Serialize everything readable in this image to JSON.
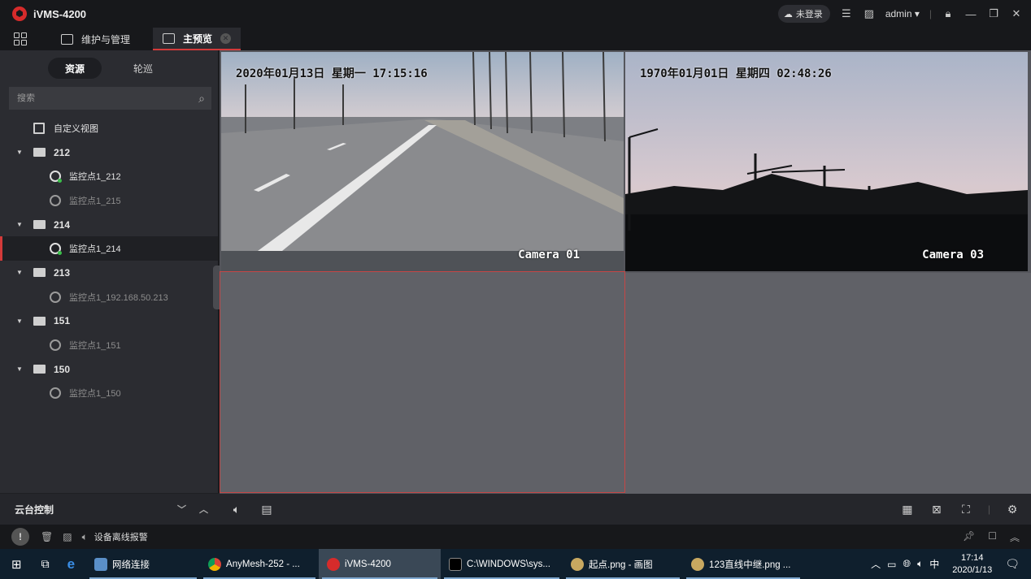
{
  "app": {
    "title": "iVMS-4200"
  },
  "titlebar": {
    "login_status": "未登录",
    "user": "admin"
  },
  "tabs": [
    {
      "label": "维护与管理"
    },
    {
      "label": "主预览"
    }
  ],
  "sidebar": {
    "segments": [
      "资源",
      "轮巡"
    ],
    "search_placeholder": "搜索",
    "custom_view": "自定义视图",
    "groups": [
      {
        "name": "212",
        "cameras": [
          {
            "label": "监控点1_212",
            "online": true
          },
          {
            "label": "监控点1_215",
            "online": false
          }
        ]
      },
      {
        "name": "214",
        "cameras": [
          {
            "label": "监控点1_214",
            "online": true,
            "selected": true
          }
        ]
      },
      {
        "name": "213",
        "cameras": [
          {
            "label": "监控点1_192.168.50.213",
            "online": false
          }
        ]
      },
      {
        "name": "151",
        "cameras": [
          {
            "label": "监控点1_151",
            "online": false
          }
        ]
      },
      {
        "name": "150",
        "cameras": [
          {
            "label": "监控点1_150",
            "online": false
          }
        ]
      }
    ],
    "ptz_label": "云台控制"
  },
  "video": {
    "pane1": {
      "timestamp": "2020年01月13日 星期一 17:15:16",
      "camera": "Camera 01"
    },
    "pane2": {
      "timestamp": "1970年01月01日 星期四 02:48:26",
      "camera": "Camera 03"
    }
  },
  "statusbar": {
    "alarm_text": "设备离线报警"
  },
  "taskbar": {
    "items": [
      {
        "label": "网络连接"
      },
      {
        "label": "AnyMesh-252 - ..."
      },
      {
        "label": "iVMS-4200"
      },
      {
        "label": "C:\\WINDOWS\\sys..."
      },
      {
        "label": "起点.png - 画图"
      },
      {
        "label": "123直线中继.png ..."
      }
    ],
    "ime": "中",
    "time": "17:14",
    "date": "2020/1/13"
  },
  "colors": {
    "accent": "#d33a3a",
    "online": "#3bbf4a",
    "bg": "#2b2c31"
  }
}
